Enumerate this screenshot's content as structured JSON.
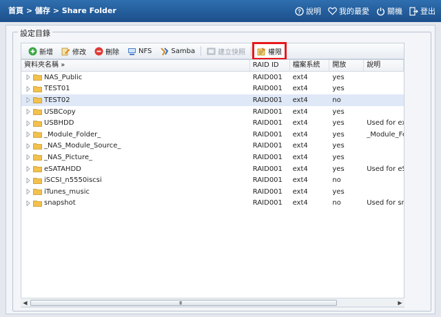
{
  "breadcrumb": "首頁 > 儲存 > Share Folder",
  "nav": {
    "help": "說明",
    "favorites": "我的最愛",
    "shutdown": "關機",
    "logout": "登出"
  },
  "section_title": "設定目錄",
  "toolbar": {
    "add": "新增",
    "edit": "修改",
    "delete": "刪除",
    "nfs": "NFS",
    "samba": "Samba",
    "snapshot": "建立快照",
    "permissions": "權限"
  },
  "columns": {
    "name": "資料夾名稱 »",
    "raid": "RAID ID",
    "fs": "檔案系統",
    "public": "開放",
    "desc": "說明"
  },
  "rows": [
    {
      "name": "NAS_Public",
      "raid": "RAID001",
      "fs": "ext4",
      "public": "yes",
      "desc": ""
    },
    {
      "name": "TEST01",
      "raid": "RAID001",
      "fs": "ext4",
      "public": "yes",
      "desc": ""
    },
    {
      "name": "TEST02",
      "raid": "RAID001",
      "fs": "ext4",
      "public": "no",
      "desc": ""
    },
    {
      "name": "USBCopy",
      "raid": "RAID001",
      "fs": "ext4",
      "public": "yes",
      "desc": ""
    },
    {
      "name": "USBHDD",
      "raid": "RAID001",
      "fs": "ext4",
      "public": "yes",
      "desc": "Used for exte"
    },
    {
      "name": "_Module_Folder_",
      "raid": "RAID001",
      "fs": "ext4",
      "public": "yes",
      "desc": "_Module_Fol"
    },
    {
      "name": "_NAS_Module_Source_",
      "raid": "RAID001",
      "fs": "ext4",
      "public": "yes",
      "desc": ""
    },
    {
      "name": "_NAS_Picture_",
      "raid": "RAID001",
      "fs": "ext4",
      "public": "yes",
      "desc": ""
    },
    {
      "name": "eSATAHDD",
      "raid": "RAID001",
      "fs": "ext4",
      "public": "yes",
      "desc": "Used for eSA"
    },
    {
      "name": "iSCSI_n5550iscsi",
      "raid": "RAID001",
      "fs": "ext4",
      "public": "no",
      "desc": ""
    },
    {
      "name": "iTunes_music",
      "raid": "RAID001",
      "fs": "ext4",
      "public": "yes",
      "desc": ""
    },
    {
      "name": "snapshot",
      "raid": "RAID001",
      "fs": "ext4",
      "public": "no",
      "desc": "Used for sna"
    }
  ],
  "selected_row": "TEST02",
  "scrollbar_grip": "III",
  "colors": {
    "topbar": "#1b4f8a",
    "highlight": "#e8171c",
    "selected_row": "#dfe8f6",
    "folder": "#f2c14e"
  }
}
